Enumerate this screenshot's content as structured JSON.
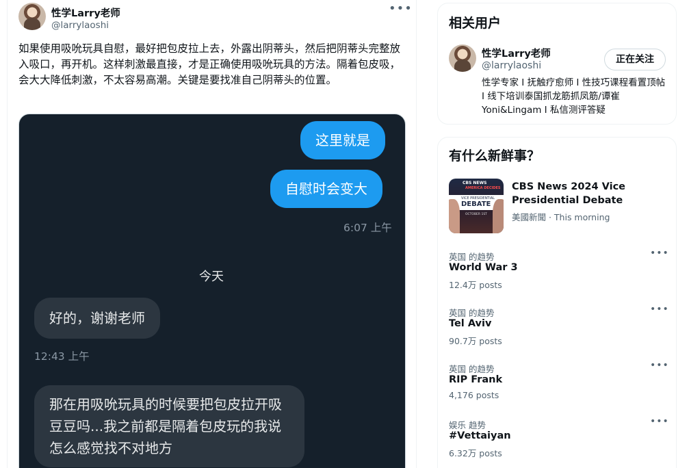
{
  "tweet": {
    "author_name": "性学Larry老师",
    "author_handle": "@larrylaoshi",
    "more_icon": "•••",
    "text": "如果使用吸吮玩具自慰，最好把包皮拉上去，外露出阴蒂头，然后把阴蒂头完整放入吸口，再开机。这样刺激最直接，才是正确使用吸吮玩具的方法。隔着包皮吸，会大大降低刺激，不太容易高潮。关键是要找准自己阴蒂头的位置。"
  },
  "chat": {
    "bubble_out_1": "这里就是",
    "bubble_out_2": "自慰时会变大",
    "time_1": "6:07 上午",
    "date_label": "今天",
    "bubble_in_1": "好的，谢谢老师",
    "time_2": "12:43 上午",
    "bubble_in_2": "那在用吸吮玩具的时候要把包皮拉开吸豆豆吗...我之前都是隔着包皮玩的我说怎么感觉找不对地方"
  },
  "related": {
    "title": "相关用户",
    "user_name": "性学Larry老师",
    "user_handle": "@larrylaoshi",
    "follow_label": "正在关注",
    "bio": "性学专家 I 抚触疗愈师 I 性技巧课程看置顶帖 I 线下培训泰国抓龙筋抓凤筋/谭崔Yoni&Lingam I 私信测评答疑"
  },
  "whats_new": {
    "title": "有什么新鲜事？",
    "news": {
      "title": "CBS News 2024 Vice Presidential Debate",
      "meta": "美國新聞 · This morning",
      "thumb_brand": "CBS NEWS",
      "thumb_sub": "AMERICA DECIDES",
      "thumb_line": "VICE PRESIDENTIAL",
      "thumb_main": "DEBATE",
      "thumb_date": "OCTOBER 1ST"
    },
    "trends": [
      {
        "context": "英国 的趋势",
        "name": "World War 3",
        "posts": "12.4万 posts"
      },
      {
        "context": "英国 的趋势",
        "name": "Tel Aviv",
        "posts": "90.7万 posts"
      },
      {
        "context": "英国 的趋势",
        "name": "RIP Frank",
        "posts": "4,176 posts"
      },
      {
        "context": "娱乐 趋势",
        "name": "#Vettaiyan",
        "posts": "6.32万 posts"
      }
    ],
    "more_icon": "•••"
  }
}
